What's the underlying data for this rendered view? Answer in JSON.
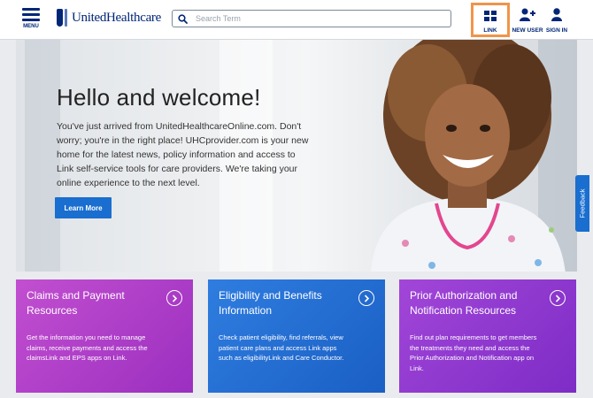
{
  "header": {
    "menu_label": "MENU",
    "logo_text": "UnitedHealthcare",
    "search_placeholder": "Search Term",
    "nav": [
      {
        "label": "LINK",
        "icon": "grid-icon"
      },
      {
        "label": "NEW USER",
        "icon": "add-user-icon"
      },
      {
        "label": "SIGN IN",
        "icon": "user-icon"
      }
    ]
  },
  "hero": {
    "title": "Hello and welcome!",
    "body": "You've just arrived from UnitedHealthcareOnline.com. Don't worry; you're in the right place! UHCprovider.com is your new home for the latest news, policy information and access to Link self-service tools for care providers. We're taking your online experience to the next level.",
    "button": "Learn More"
  },
  "feedback_tab": "Feedback",
  "cards": [
    {
      "title": "Claims and Payment Resources",
      "description": "Get the information you need to manage claims, receive payments and access the claimsLink and EPS apps on Link."
    },
    {
      "title": "Eligibility and Benefits Information",
      "description": "Check patient eligibility, find referrals, view patient care plans and access Link apps such as eligibilityLink and Care Conductor."
    },
    {
      "title": "Prior Authorization and Notification Resources",
      "description": "Find out plan requirements to get members the treatments they need and access the Prior Authorization and Notification app on Link."
    }
  ],
  "colors": {
    "brand_navy": "#002677",
    "accent_blue": "#196ecf",
    "highlight_orange": "#f0944a",
    "card_claims": "#b040cc",
    "card_eligibility": "#2670d6",
    "card_prior_auth": "#9039d0"
  }
}
